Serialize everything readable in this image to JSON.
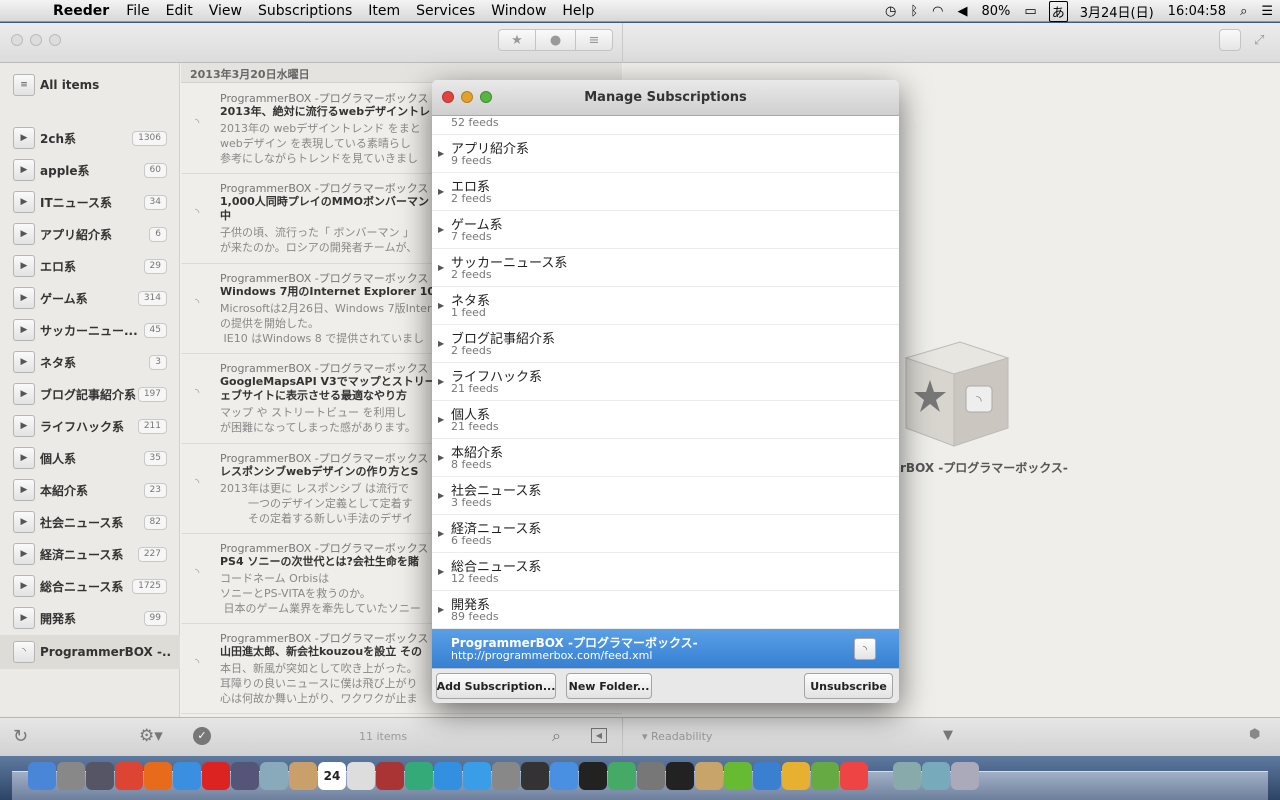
{
  "menubar": {
    "app": "Reeder",
    "items": [
      "File",
      "Edit",
      "View",
      "Subscriptions",
      "Item",
      "Services",
      "Window",
      "Help"
    ],
    "battery": "80%",
    "ime": "あ",
    "date": "3月24日(日)",
    "time": "16:04:58"
  },
  "sidebar": {
    "all_items": "All items",
    "folders": [
      {
        "label": "2ch系",
        "count": "1306"
      },
      {
        "label": "apple系",
        "count": "60"
      },
      {
        "label": "ITニュース系",
        "count": "34"
      },
      {
        "label": "アプリ紹介系",
        "count": "6"
      },
      {
        "label": "エロ系",
        "count": "29"
      },
      {
        "label": "ゲーム系",
        "count": "314"
      },
      {
        "label": "サッカーニュー...",
        "count": "45"
      },
      {
        "label": "ネタ系",
        "count": "3"
      },
      {
        "label": "ブログ記事紹介系",
        "count": "197"
      },
      {
        "label": "ライフハック系",
        "count": "211"
      },
      {
        "label": "個人系",
        "count": "35"
      },
      {
        "label": "本紹介系",
        "count": "23"
      },
      {
        "label": "社会ニュース系",
        "count": "82"
      },
      {
        "label": "経済ニュース系",
        "count": "227"
      },
      {
        "label": "総合ニュース系",
        "count": "1725"
      },
      {
        "label": "開発系",
        "count": "99"
      }
    ],
    "selected_feed": "ProgrammerBOX -..."
  },
  "list": {
    "date_header": "2013年3月20日水曜日",
    "articles": [
      {
        "source": "ProgrammerBOX -プログラマーボックス",
        "title": "2013年、絶対に流行るwebデザイントレ",
        "excerpt": "2013年の webデザイントレンド をまと\nwebデザイン を表現している素晴らし\n参考にしながらトレンドを見ていきまし"
      },
      {
        "source": "ProgrammerBOX -プログラマーボックス",
        "title": "1,000人同時プレイのMMOボンバーマン\n中",
        "excerpt": "子供の頃、流行った「 ボンバーマン 」\nが来たのか。ロシアの開発者チームが、"
      },
      {
        "source": "ProgrammerBOX -プログラマーボックス",
        "title": "Windows 7用のInternet Explorer 10,",
        "excerpt": "Microsoftは2月26日、Windows 7版Inter\nの提供を開始した。\n IE10 はWindows 8 で提供されていまし"
      },
      {
        "source": "ProgrammerBOX -プログラマーボックス",
        "title": "GoogleMapsAPI V3でマップとストリー\nェブサイトに表示させる最適なやり方",
        "excerpt": "マップ や ストリートビュー を利用し\nが困難になってしまった感があります。"
      },
      {
        "source": "ProgrammerBOX -プログラマーボックス",
        "title": "レスポンシブwebデザインの作り方とS",
        "excerpt": "2013年は更に レスポンシブ は流行で\n        一つのデザイン定義として定着す\n        その定着する新しい手法のデザイ"
      },
      {
        "source": "ProgrammerBOX -プログラマーボックス",
        "title": "PS4 ソニーの次世代とは?会社生命を賭",
        "excerpt": "コードネーム Orbisは\nソニーとPS-VITAを救うのか。\n 日本のゲーム業界を牽先していたソニー"
      },
      {
        "source": "ProgrammerBOX -プログラマーボックス",
        "title": "山田進太郎、新会社kouzouを設立 その",
        "excerpt": "本日、新風が突如として吹き上がった。\n耳障りの良いニュースに僕は飛び上がり\n心は何故か舞い上がり、ワクワクが止ま"
      }
    ]
  },
  "reader": {
    "source_title": "rBOX -プログラマーボックス-"
  },
  "bottombar": {
    "items_count": "11 items",
    "readability": "Readability"
  },
  "dialog": {
    "title": "Manage Subscriptions",
    "partial_row_feeds": "52 feeds",
    "folders": [
      {
        "name": "アプリ紹介系",
        "feeds": "9 feeds"
      },
      {
        "name": "エロ系",
        "feeds": "2 feeds"
      },
      {
        "name": "ゲーム系",
        "feeds": "7 feeds"
      },
      {
        "name": "サッカーニュース系",
        "feeds": "2 feeds"
      },
      {
        "name": "ネタ系",
        "feeds": "1 feed"
      },
      {
        "name": "ブログ記事紹介系",
        "feeds": "2 feeds"
      },
      {
        "name": "ライフハック系",
        "feeds": "21 feeds"
      },
      {
        "name": "個人系",
        "feeds": "21 feeds"
      },
      {
        "name": "本紹介系",
        "feeds": "8 feeds"
      },
      {
        "name": "社会ニュース系",
        "feeds": "3 feeds"
      },
      {
        "name": "経済ニュース系",
        "feeds": "6 feeds"
      },
      {
        "name": "総合ニュース系",
        "feeds": "12 feeds"
      },
      {
        "name": "開発系",
        "feeds": "89 feeds"
      }
    ],
    "selected_feed": {
      "name": "ProgrammerBOX -プログラマーボックス-",
      "url": "http://programmerbox.com/feed.xml"
    },
    "buttons": {
      "add": "Add Subscription...",
      "new_folder": "New Folder...",
      "unsubscribe": "Unsubscribe"
    }
  },
  "dock": {
    "apps": [
      "finder",
      "launchpad",
      "mission-control",
      "chrome",
      "firefox",
      "safari",
      "opera",
      "network",
      "preview",
      "contacts",
      "calendar",
      "textedit",
      "photo-booth",
      "iphoto",
      "itunes",
      "app-store",
      "system-preferences",
      "steam",
      "dropbox",
      "terminal",
      "x11",
      "automator",
      "activity-monitor",
      "package",
      "leaf",
      "xcode",
      "sketch",
      "evernote",
      "pocket",
      "folder",
      "downloads",
      "trash"
    ],
    "calendar_day": "24"
  },
  "colors": {
    "selection_blue": "#3b86d8",
    "close_red": "#e0443e",
    "min_yellow": "#e0a22c",
    "zoom_green": "#57b542"
  }
}
